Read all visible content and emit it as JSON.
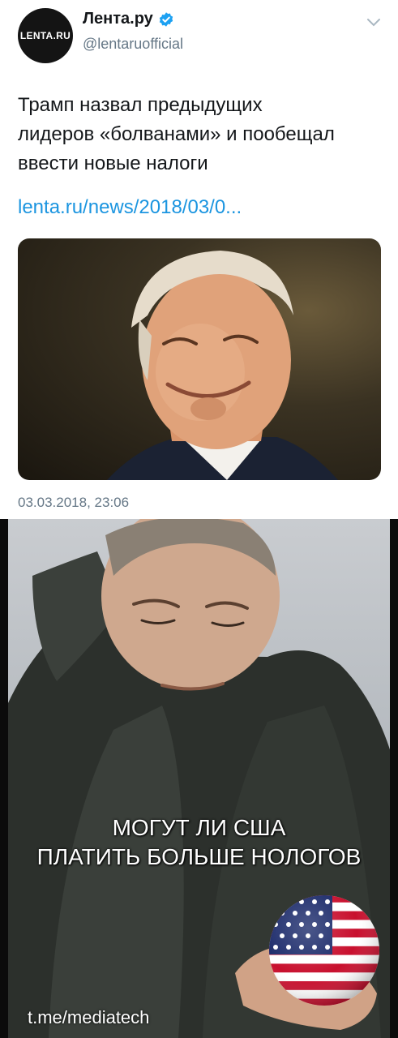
{
  "tweet": {
    "avatar_text": "LENTA.RU",
    "name": "Лента.ру",
    "handle": "@lentaruofficial",
    "text_lines": [
      "Трамп назвал предыдущих",
      "лидеров «болванами» и пообещал",
      "ввести новые налоги"
    ],
    "link": "lenta.ru/news/2018/03/0...",
    "timestamp": "03.03.2018, 23:06"
  },
  "meme": {
    "caption_lines": [
      "МОГУТ ЛИ США",
      "ПЛАТИТЬ БОЛЬШЕ НОЛОГОВ"
    ],
    "watermark": "t.me/mediatech"
  },
  "colors": {
    "link": "#1b95e0",
    "secondary_text": "#657786",
    "verified_badge": "#1da1f2"
  }
}
